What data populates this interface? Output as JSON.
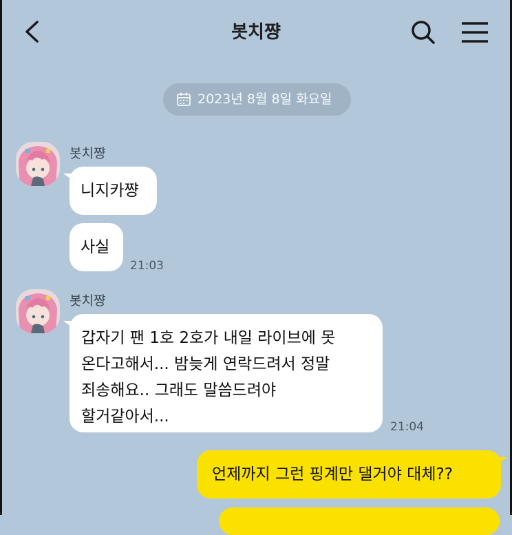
{
  "header": {
    "title": "봇치쨩",
    "back_icon": "chevron-left-icon",
    "search_icon": "search-icon",
    "menu_icon": "hamburger-menu-icon"
  },
  "date_divider": {
    "text": "2023년 8월 8일 화요일",
    "icon": "calendar-icon"
  },
  "messages": [
    {
      "sender": "봇치쨩",
      "bubbles": [
        {
          "text": "니지카쨩"
        },
        {
          "text": "사실",
          "time": "21:03"
        }
      ]
    },
    {
      "sender": "봇치쨩",
      "bubbles": [
        {
          "lines": [
            "갑자기 팬 1호 2호가 내일 라이브에 못",
            "온다고해서... 밤늦게 연락드려서 정말",
            "죄송해요.. 그래도 말씀드려야",
            "할거같아서..."
          ],
          "time": "21:04"
        }
      ]
    }
  ],
  "my_messages": [
    {
      "text": "언제까지 그런 핑계만 댈거야 대체??"
    },
    {
      "text": ""
    }
  ],
  "colors": {
    "background": "#b2c7d9",
    "my_bubble": "#fae100",
    "other_bubble": "#ffffff",
    "date_pill": "#9fb3c5"
  }
}
